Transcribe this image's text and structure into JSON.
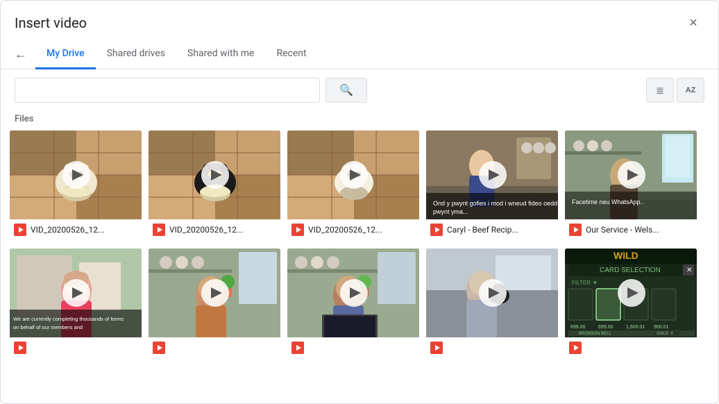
{
  "dialog": {
    "title": "Insert video",
    "close_label": "×"
  },
  "nav": {
    "back_icon": "←",
    "tabs": [
      {
        "label": "My Drive",
        "active": true
      },
      {
        "label": "Shared drives",
        "active": false
      },
      {
        "label": "Shared with me",
        "active": false
      },
      {
        "label": "Recent",
        "active": false
      }
    ]
  },
  "search": {
    "placeholder": "",
    "button_icon": "🔍"
  },
  "view_controls": {
    "list_icon": "≡",
    "sort_icon": "AZ"
  },
  "section": {
    "label": "Files"
  },
  "files": [
    {
      "name": "VID_20200526_12...",
      "thumbnail_type": "cat1",
      "icon_color": "#ea4335"
    },
    {
      "name": "VID_20200526_12...",
      "thumbnail_type": "cat2",
      "icon_color": "#ea4335"
    },
    {
      "name": "VID_20200526_12...",
      "thumbnail_type": "cat3",
      "icon_color": "#ea4335"
    },
    {
      "name": "Caryl - Beef Recip...",
      "thumbnail_type": "kitchen",
      "icon_color": "#ea4335"
    },
    {
      "name": "Our Service - Wels...",
      "thumbnail_type": "service",
      "icon_color": "#ea4335"
    },
    {
      "name": "",
      "thumbnail_type": "lady",
      "icon_color": "#ea4335"
    },
    {
      "name": "",
      "thumbnail_type": "man1",
      "icon_color": "#ea4335"
    },
    {
      "name": "",
      "thumbnail_type": "man2",
      "icon_color": "#ea4335"
    },
    {
      "name": "",
      "thumbnail_type": "person",
      "icon_color": "#ea4335"
    },
    {
      "name": "",
      "thumbnail_type": "game",
      "icon_color": "#ea4335"
    }
  ]
}
